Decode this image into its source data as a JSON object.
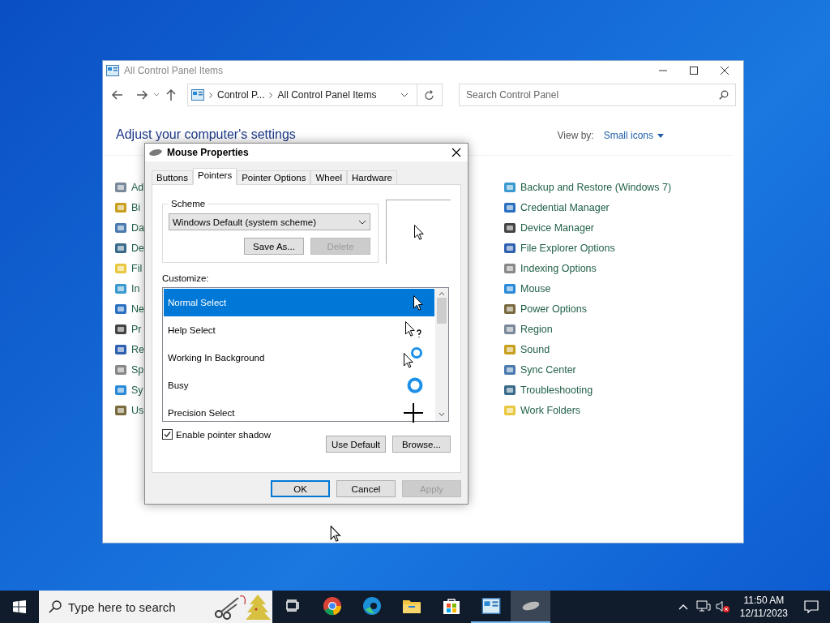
{
  "control_panel": {
    "title": "All Control Panel Items",
    "breadcrumb": [
      "Control P...",
      "All Control Panel Items"
    ],
    "search": {
      "placeholder": "Search Control Panel"
    },
    "heading": "Adjust your computer's settings",
    "view_by": {
      "label": "View by:",
      "value": "Small icons"
    },
    "items_left": [
      "Ad",
      "Bi",
      "Da",
      "De",
      "Fil",
      "In",
      "Ne",
      "Pr",
      "Re",
      "Sp",
      "Sy",
      "Us"
    ],
    "items_right": [
      "Backup and Restore (Windows 7)",
      "Credential Manager",
      "Device Manager",
      "File Explorer Options",
      "Indexing Options",
      "Mouse",
      "Power Options",
      "Region",
      "Sound",
      "Sync Center",
      "Troubleshooting",
      "Work Folders"
    ]
  },
  "dialog": {
    "title": "Mouse Properties",
    "tabs": [
      {
        "label": "Buttons",
        "selected": false
      },
      {
        "label": "Pointers",
        "selected": true
      },
      {
        "label": "Pointer Options",
        "selected": false
      },
      {
        "label": "Wheel",
        "selected": false
      },
      {
        "label": "Hardware",
        "selected": false
      }
    ],
    "scheme": {
      "label": "Scheme",
      "value": "Windows Default (system scheme)",
      "buttons": [
        {
          "label": "Save As...",
          "disabled": false
        },
        {
          "label": "Delete",
          "disabled": true
        }
      ]
    },
    "customize_label": "Customize:",
    "pointers": [
      {
        "label": "Normal Select",
        "selected": true,
        "kind": "arrow"
      },
      {
        "label": "Help Select",
        "selected": false,
        "kind": "help"
      },
      {
        "label": "Working In Background",
        "selected": false,
        "kind": "working"
      },
      {
        "label": "Busy",
        "selected": false,
        "kind": "busy"
      },
      {
        "label": "Precision Select",
        "selected": false,
        "kind": "cross"
      }
    ],
    "shadow": {
      "label": "Enable pointer shadow",
      "checked": true
    },
    "list_buttons": [
      "Use Default",
      "Browse..."
    ],
    "buttons": [
      {
        "label": "OK",
        "default": true,
        "disabled": false
      },
      {
        "label": "Cancel",
        "default": false,
        "disabled": false
      },
      {
        "label": "Apply",
        "default": false,
        "disabled": true
      }
    ]
  },
  "taskbar": {
    "search_placeholder": "Type here to search",
    "apps": [
      {
        "kind": "taskview",
        "open": false,
        "selected": false
      },
      {
        "kind": "chrome",
        "open": false,
        "selected": false
      },
      {
        "kind": "edge",
        "open": false,
        "selected": false
      },
      {
        "kind": "explorer",
        "open": false,
        "selected": false
      },
      {
        "kind": "store",
        "open": false,
        "selected": false
      },
      {
        "kind": "controlpanel",
        "open": true,
        "selected": false
      },
      {
        "kind": "mouse",
        "open": true,
        "selected": true
      }
    ],
    "time": "11:50 AM",
    "date": "12/11/2023"
  }
}
